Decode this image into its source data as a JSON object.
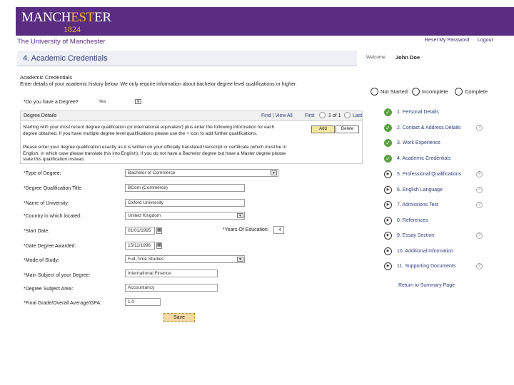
{
  "header": {
    "logo_text_1": "MANCH",
    "logo_text_est": "EST",
    "logo_text_2": "ER",
    "logo_year": "1824",
    "university_name": "The University of Manchester",
    "reset_password": "Reset My Password",
    "logout": "Logout",
    "colors": {
      "banner": "#5a2d82",
      "accent": "#f2b233"
    }
  },
  "page": {
    "title": "4. Academic Credentials",
    "welcome_label": "Welcome",
    "user_name": "John Doe"
  },
  "form": {
    "section_title": "Academic Credentials",
    "section_desc": "Enter details of your academic history below. We only require information about bachelor degree level qualifications or higher.",
    "have_degree_label": "*Do you have a Degree?",
    "have_degree_value": "Yes",
    "grid": {
      "title": "Degree Details",
      "find_view": "Find | View All",
      "first": "First",
      "page": "1 of 1",
      "last": "Last",
      "add_label": "Add",
      "delete_label": "Delete",
      "instruction_1_line1": "Starting with your most recent degree qualification (or international equivalent) plus enter the following information for each",
      "instruction_1_line2": "degree obtained. If you have multiple degree level qualifications please use the + icon to add further qualifications.",
      "instruction_2_line1": "Please enter your degree qualification exactly as it is written on your officially translated transcript or certificate (which must be in",
      "instruction_2_line2": "English, in which case please translate this into English). If you do not have a Bachelor degree but have a Master degree please",
      "instruction_2_line3": "state this qualification instead."
    },
    "fields": {
      "type_of_degree": {
        "label": "*Type of Degree:",
        "value": "Bachelor of Commerce"
      },
      "degree_title": {
        "label": "*Degree Qualification Title:",
        "value": "BCom (Commerce)"
      },
      "university": {
        "label": "*Name of University:",
        "value": "Oxford University"
      },
      "country": {
        "label": "*Country in which located:",
        "value": "United Kingdom"
      },
      "start_date": {
        "label": "*Start Date:",
        "value": "01/01/1995"
      },
      "years_education": {
        "label": "*Years Of Education:",
        "value": "4"
      },
      "date_awarded": {
        "label": "*Date Degree Awarded:",
        "value": "15/11/1996"
      },
      "mode_of_study": {
        "label": "*Mode of Study:",
        "value": "Full-Time Studies"
      },
      "main_subject": {
        "label": "*Main Subject of your Degree:",
        "value": "International Finance"
      },
      "subject_area": {
        "label": "*Degree Subject Area:",
        "value": "Accountancy"
      },
      "final_grade": {
        "label": "*Final Grade/Overall Average/GPA:",
        "value": "1.0"
      }
    },
    "save_label": "Save"
  },
  "legend": {
    "not_started": "Not Started",
    "incomplete": "Incomplete",
    "complete": "Complete"
  },
  "steps": [
    {
      "label": "1. Personal Details",
      "status": "complete",
      "help": false
    },
    {
      "label": "2. Contact & Address Details",
      "status": "complete",
      "help": true
    },
    {
      "label": "3. Work Experience",
      "status": "complete",
      "help": false
    },
    {
      "label": "4. Academic Credentials",
      "status": "complete",
      "help": false
    },
    {
      "label": "5. Professional Qualifications",
      "status": "not_started",
      "help": true
    },
    {
      "label": "6. English Language",
      "status": "not_started",
      "help": true
    },
    {
      "label": "7. Admissions Test",
      "status": "not_started",
      "help": true
    },
    {
      "label": "8. References",
      "status": "not_started",
      "help": false
    },
    {
      "label": "9. Essay Section",
      "status": "not_started",
      "help": true
    },
    {
      "label": "10. Additional Information",
      "status": "not_started",
      "help": false
    },
    {
      "label": "11. Supporting Documents",
      "status": "not_started",
      "help": true
    }
  ],
  "return_link": "Return to Summary Page"
}
